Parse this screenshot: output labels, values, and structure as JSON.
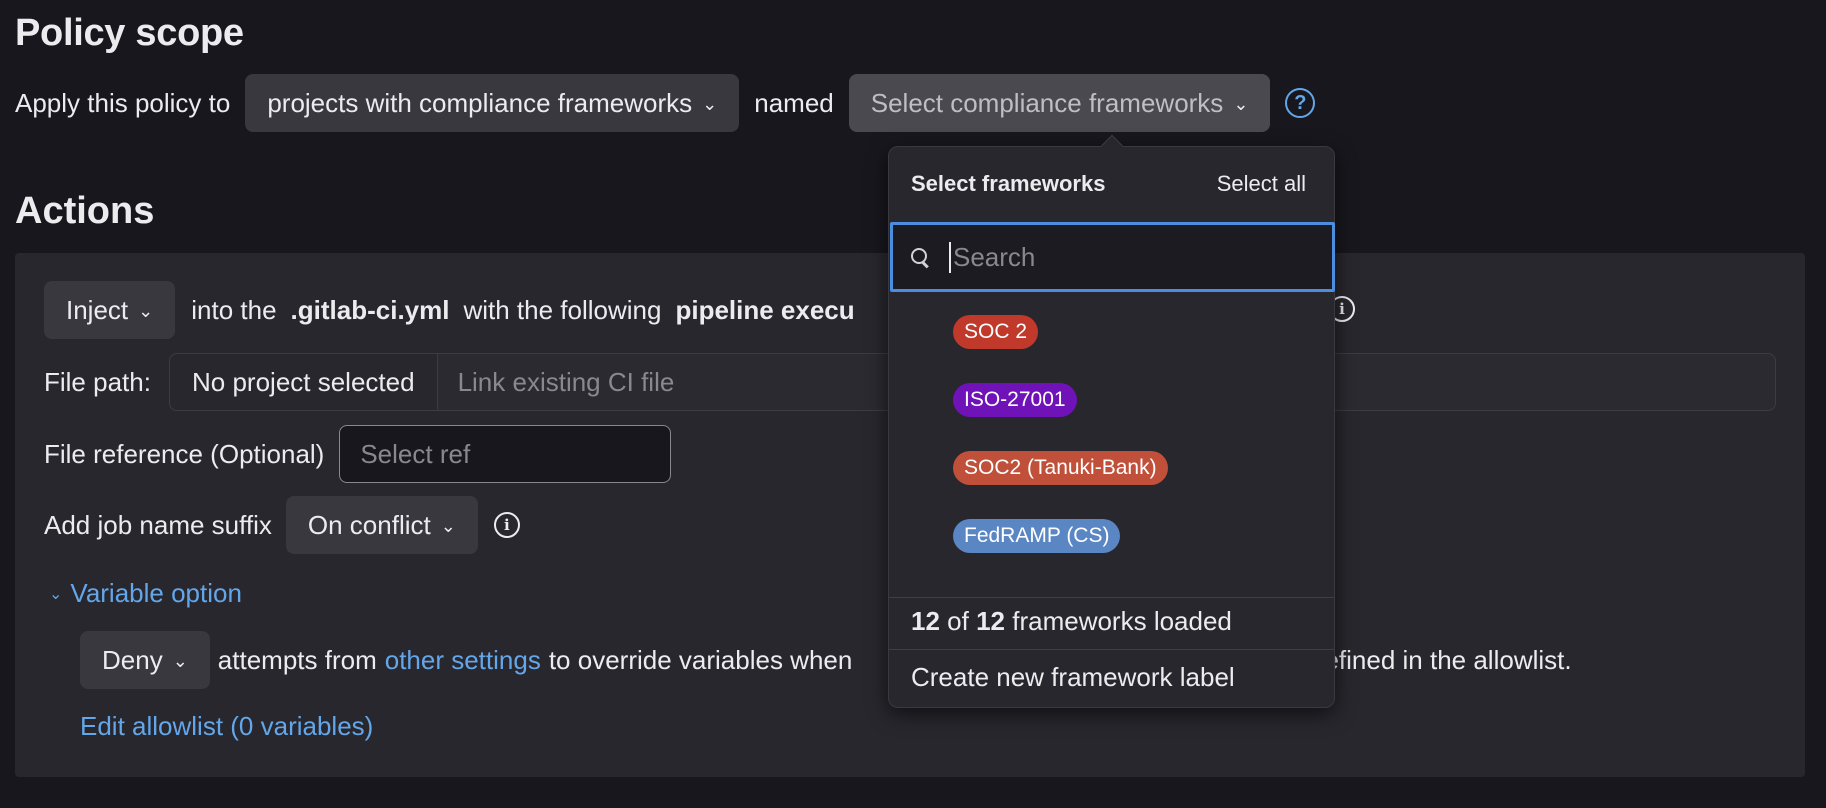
{
  "policy_scope": {
    "title": "Policy scope",
    "apply_label": "Apply this policy to",
    "scope_select": "projects with compliance frameworks",
    "named_label": "named",
    "framework_select": "Select compliance frameworks"
  },
  "actions": {
    "title": "Actions",
    "inject_select": "Inject",
    "into_the": "into the",
    "ci_file": ".gitlab-ci.yml",
    "with_following": "with the following",
    "pipeline_exec": "pipeline execu",
    "file_path_label": "File path:",
    "no_project": "No project selected",
    "link_ci_placeholder": "Link existing CI file",
    "file_ref_label": "File reference (Optional)",
    "select_ref_placeholder": "Select ref",
    "suffix_label": "Add job name suffix",
    "suffix_select": "On conflict",
    "variable_option": "Variable option",
    "deny_select": "Deny",
    "attempts_from": "attempts from",
    "other_settings": "other settings",
    "override_text_a": "to override variables when",
    "override_text_b": "defined in the allowlist.",
    "edit_allowlist": "Edit allowlist (0 variables)"
  },
  "dropdown": {
    "title": "Select frameworks",
    "select_all": "Select all",
    "search_placeholder": "Search",
    "frameworks": [
      {
        "label": "SOC 2",
        "color": "#c0392b"
      },
      {
        "label": "ISO-27001",
        "color": "#6f12b8"
      },
      {
        "label": "SOC2 (Tanuki-Bank)",
        "color": "#c0503a"
      },
      {
        "label": "FedRAMP (CS)",
        "color": "#5b86c4"
      }
    ],
    "count_loaded": "12",
    "count_total": "12",
    "count_of": "of",
    "count_suffix": "frameworks loaded",
    "create_label": "Create new framework label"
  },
  "colors": {
    "background": "#18171d",
    "panel": "#28272d",
    "link": "#63a6e9",
    "focus": "#4b8ee0"
  }
}
